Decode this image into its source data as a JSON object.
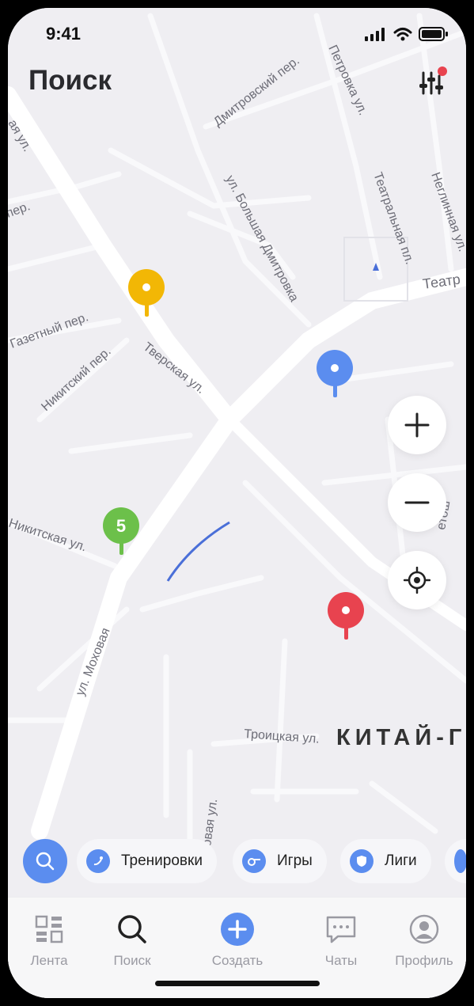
{
  "status_bar": {
    "time": "9:41"
  },
  "header": {
    "title": "Поиск"
  },
  "map": {
    "street_labels": [
      "Тверская ул.",
      "ул. Большая Дмитровка",
      "ул. Моховая",
      "Газетный пер.",
      "Никитский пер.",
      "Дмитровский пер.",
      "Петровка ул.",
      "Театральная пл.",
      "Неглинная ул.",
      "Театр",
      "Никитская ул.",
      "Троицкая ул.",
      "Боровая ул.",
      "ая ул.",
      "пер.",
      "етош"
    ],
    "district_label": "КИТАЙ-Г",
    "markers": [
      {
        "color": "#f2b705",
        "label": ""
      },
      {
        "color": "#5b8def",
        "label": ""
      },
      {
        "color": "#6cc04a",
        "label": "5"
      },
      {
        "color": "#e8434f",
        "label": ""
      }
    ],
    "controls": [
      "zoom-in",
      "zoom-out",
      "locate"
    ]
  },
  "filters": {
    "chips": [
      {
        "label": "Тренировки",
        "icon": "training-icon"
      },
      {
        "label": "Игры",
        "icon": "whistle-icon"
      },
      {
        "label": "Лиги",
        "icon": "shield-icon"
      }
    ]
  },
  "tabbar": {
    "tabs": [
      {
        "label": "Лента",
        "icon": "grid-icon",
        "active": false
      },
      {
        "label": "Поиск",
        "icon": "search-icon",
        "active": true
      },
      {
        "label": "Создать",
        "icon": "plus-icon",
        "active": false
      },
      {
        "label": "Чаты",
        "icon": "chat-icon",
        "active": false
      },
      {
        "label": "Профиль",
        "icon": "profile-icon",
        "active": false
      }
    ]
  },
  "colors": {
    "accent": "#5b8def",
    "map_bg": "#efeef2",
    "road": "#ffffff"
  }
}
